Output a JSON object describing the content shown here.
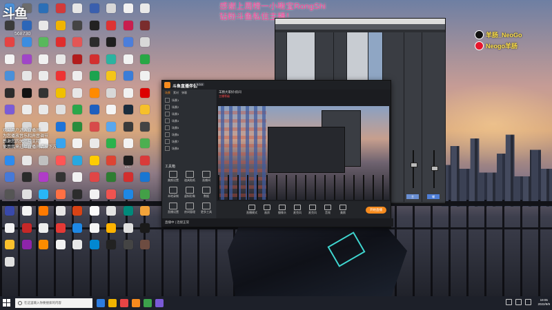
{
  "overlay": {
    "logo": "斗鱼",
    "room_id": "568730",
    "thanks_line1": "感谢上周榜一小啾宝RongShi",
    "thanks_line2": "钻粉斗鱼私信主播！",
    "tiktok_handle": "羊肠_NeoGo",
    "weibo_handle": "Neogo羊肠",
    "chat_line1": "欢迎用户进入直播间",
    "chat_line2": "为您播放音乐和声音调节",
    "chat_line3": "感谢您的关注与支持",
    "chat_line4": "使用我来过年直播间请按下方"
  },
  "desktop_icons": [
    {
      "label": "此电脑",
      "color": "#4a90d9"
    },
    {
      "label": "",
      "color": "#6c6c6c"
    },
    {
      "label": "",
      "color": "#2b6fb7"
    },
    {
      "label": "",
      "color": "#d23a3a"
    },
    {
      "label": "",
      "color": "#e6e6e6"
    },
    {
      "label": "",
      "color": "#3a5fae"
    },
    {
      "label": "",
      "color": "#d7d7d7"
    },
    {
      "label": "",
      "color": "#f1f1f1"
    },
    {
      "label": "",
      "color": "#e9e9e9"
    },
    {
      "label": "",
      "color": "#3b3b3b"
    },
    {
      "label": "",
      "color": "#2c66b8"
    },
    {
      "label": "",
      "color": "#e8e8e8"
    },
    {
      "label": "",
      "color": "#f0b400"
    },
    {
      "label": "",
      "color": "#444"
    },
    {
      "label": "",
      "color": "#222"
    },
    {
      "label": "",
      "color": "#d33"
    },
    {
      "label": "",
      "color": "#c81e4f"
    },
    {
      "label": "",
      "color": "#7a2d2d"
    },
    {
      "label": "",
      "color": "#e54343"
    },
    {
      "label": "",
      "color": "#3c8de0"
    },
    {
      "label": "",
      "color": "#58b85c"
    },
    {
      "label": "",
      "color": "#e02d2d"
    },
    {
      "label": "",
      "color": "#e35656"
    },
    {
      "label": "",
      "color": "#2b2b2b"
    },
    {
      "label": "",
      "color": "#1f1f1f"
    },
    {
      "label": "",
      "color": "#4c7edb"
    },
    {
      "label": "",
      "color": "#d8d8d8"
    },
    {
      "label": "",
      "color": "#f4f4f4"
    },
    {
      "label": "",
      "color": "#a046c8"
    },
    {
      "label": "",
      "color": "#f1f1f1"
    },
    {
      "label": "",
      "color": "#e8e8e8"
    },
    {
      "label": "",
      "color": "#b21c1c"
    },
    {
      "label": "",
      "color": "#d32f2f"
    },
    {
      "label": "",
      "color": "#2bb3a0"
    },
    {
      "label": "",
      "color": "#f2f2f2"
    },
    {
      "label": "",
      "color": "#28a745"
    },
    {
      "label": "",
      "color": "#4a90d9"
    },
    {
      "label": "",
      "color": "#e6e6e6"
    },
    {
      "label": "",
      "color": "#ebebeb"
    },
    {
      "label": "",
      "color": "#e33"
    },
    {
      "label": "",
      "color": "#eee"
    },
    {
      "label": "",
      "color": "#1ca34f"
    },
    {
      "label": "",
      "color": "#f5c518"
    },
    {
      "label": "",
      "color": "#3b7dd8"
    },
    {
      "label": "",
      "color": "#f0f0f0"
    },
    {
      "label": "",
      "color": "#2c2c2c"
    },
    {
      "label": "",
      "color": "#111"
    },
    {
      "label": "",
      "color": "#333"
    },
    {
      "label": "",
      "color": "#f0c000"
    },
    {
      "label": "",
      "color": "#e7e7e7"
    },
    {
      "label": "",
      "color": "#ff8a00"
    },
    {
      "label": "",
      "color": "#d8d8d8"
    },
    {
      "label": "",
      "color": "#f1f1f1"
    },
    {
      "label": "",
      "color": "#d00"
    },
    {
      "label": "",
      "color": "#7b5cd6"
    },
    {
      "label": "",
      "color": "#ececec"
    },
    {
      "label": "",
      "color": "#e9e9e9"
    },
    {
      "label": "",
      "color": "#e0e0e0"
    },
    {
      "label": "",
      "color": "#2aa74a"
    },
    {
      "label": "",
      "color": "#1f5fbf"
    },
    {
      "label": "",
      "color": "#f4f4f4"
    },
    {
      "label": "",
      "color": "#1b2c3c"
    },
    {
      "label": "",
      "color": "#f6c02a"
    },
    {
      "label": "",
      "color": "#e6e6e6"
    },
    {
      "label": "",
      "color": "#d9d9d9"
    },
    {
      "label": "",
      "color": "#e5e5e5"
    },
    {
      "label": "",
      "color": "#1e73d8"
    },
    {
      "label": "",
      "color": "#2a8c3c"
    },
    {
      "label": "",
      "color": "#d74a4a"
    },
    {
      "label": "",
      "color": "#5aa7ee"
    },
    {
      "label": "",
      "color": "#3a3a3a"
    },
    {
      "label": "",
      "color": "#444"
    },
    {
      "label": "",
      "color": "#222"
    },
    {
      "label": "",
      "color": "#d5d5d5"
    },
    {
      "label": "",
      "color": "#f0f0f0"
    },
    {
      "label": "",
      "color": "#38a4f0"
    },
    {
      "label": "",
      "color": "#f2f2f2"
    },
    {
      "label": "",
      "color": "#eaeaea"
    },
    {
      "label": "",
      "color": "#2bb24c"
    },
    {
      "label": "",
      "color": "#f3f3f3"
    },
    {
      "label": "",
      "color": "#4caf50"
    },
    {
      "label": "",
      "color": "#2d8cf0"
    },
    {
      "label": "",
      "color": "#e8e8e8"
    },
    {
      "label": "",
      "color": "#c0c0c0"
    },
    {
      "label": "",
      "color": "#f55"
    },
    {
      "label": "",
      "color": "#29a8e0"
    },
    {
      "label": "",
      "color": "#fc0"
    },
    {
      "label": "",
      "color": "#d43"
    },
    {
      "label": "EPIC",
      "color": "#1d1d1d"
    },
    {
      "label": "",
      "color": "#d93a3a"
    },
    {
      "label": "",
      "color": "#4779d8"
    },
    {
      "label": "",
      "color": "#2a2a2a"
    },
    {
      "label": "",
      "color": "#b03cc8"
    },
    {
      "label": "",
      "color": "#333"
    },
    {
      "label": "",
      "color": "#f1f1f1"
    },
    {
      "label": "",
      "color": "#e04646"
    },
    {
      "label": "",
      "color": "#2e7d32"
    },
    {
      "label": "",
      "color": "#d32f2f"
    },
    {
      "label": "",
      "color": "#1976d2"
    },
    {
      "label": "",
      "color": "#555"
    },
    {
      "label": "",
      "color": "#e0e0e0"
    },
    {
      "label": "",
      "color": "#29b6f6"
    },
    {
      "label": "",
      "color": "#ff7043"
    },
    {
      "label": "",
      "color": "#2c2c2c"
    },
    {
      "label": "",
      "color": "#f2f2f2"
    },
    {
      "label": "",
      "color": "#ef5350"
    },
    {
      "label": "",
      "color": "#1e88e5"
    },
    {
      "label": "",
      "color": "#43a047"
    },
    {
      "label": "",
      "color": "#3949ab"
    },
    {
      "label": "",
      "color": "#f4f4f4"
    },
    {
      "label": "",
      "color": "#ff7a00"
    },
    {
      "label": "",
      "color": "#e6e6e6"
    },
    {
      "label": "",
      "color": "#d84315"
    },
    {
      "label": "",
      "color": "#fafafa"
    },
    {
      "label": "",
      "color": "#e3e3e3"
    },
    {
      "label": "",
      "color": "#00897b"
    },
    {
      "label": "",
      "color": "#f2a33a"
    },
    {
      "label": "",
      "color": "#f3f3f3"
    },
    {
      "label": "",
      "color": "#c62828"
    },
    {
      "label": "",
      "color": "#eeeeee"
    },
    {
      "label": "",
      "color": "#e53935"
    },
    {
      "label": "",
      "color": "#1e88e5"
    },
    {
      "label": "",
      "color": "#f5f5f5"
    },
    {
      "label": "",
      "color": "#ffb300"
    },
    {
      "label": "",
      "color": "#e0e0e0"
    },
    {
      "label": "",
      "color": "#1a1a1a"
    },
    {
      "label": "",
      "color": "#fbc02d"
    },
    {
      "label": "",
      "color": "#8e24aa"
    },
    {
      "label": "",
      "color": "#fb8c00"
    },
    {
      "label": "",
      "color": "#f1f1f1"
    },
    {
      "label": "",
      "color": "#e8e8e8"
    },
    {
      "label": "",
      "color": "#0288d1"
    },
    {
      "label": "",
      "color": "#222"
    },
    {
      "label": "",
      "color": "#444"
    },
    {
      "label": "",
      "color": "#6d4c41"
    },
    {
      "label": "",
      "color": "#e0e0e0"
    }
  ],
  "streaming_app": {
    "name": "斗鱼直播伴侣",
    "version": "5.0.0",
    "side_tabs": [
      "场景",
      "素材",
      "弹幕"
    ],
    "scenes": [
      "场景1",
      "场景2",
      "场景3",
      "场景4",
      "场景5",
      "场景6",
      "场景7",
      "场景8"
    ],
    "tools_title": "工具箱",
    "tools": [
      "美颜设置",
      "道具贴纸",
      "直播间",
      "本地录制",
      "虚拟形象",
      "数据",
      "直播设置",
      "房间管理",
      "更多工具"
    ],
    "room_title": "羊肠大家好!房间",
    "room_sub": "主播等级",
    "bottom_controls": [
      "直播模式",
      "画质",
      "摄像头",
      "麦克风",
      "麦克风",
      "音效",
      "美颜"
    ],
    "live_button": "开始直播",
    "status_text": "直播中 | 连接正常"
  },
  "mixer": {
    "title": "混音控制台",
    "buttons": [
      "M",
      "S",
      "主",
      "辅"
    ]
  },
  "taskbar": {
    "search_placeholder": "在这里输入你要搜索的内容",
    "time": "19:05",
    "date": "2022/9/9"
  }
}
